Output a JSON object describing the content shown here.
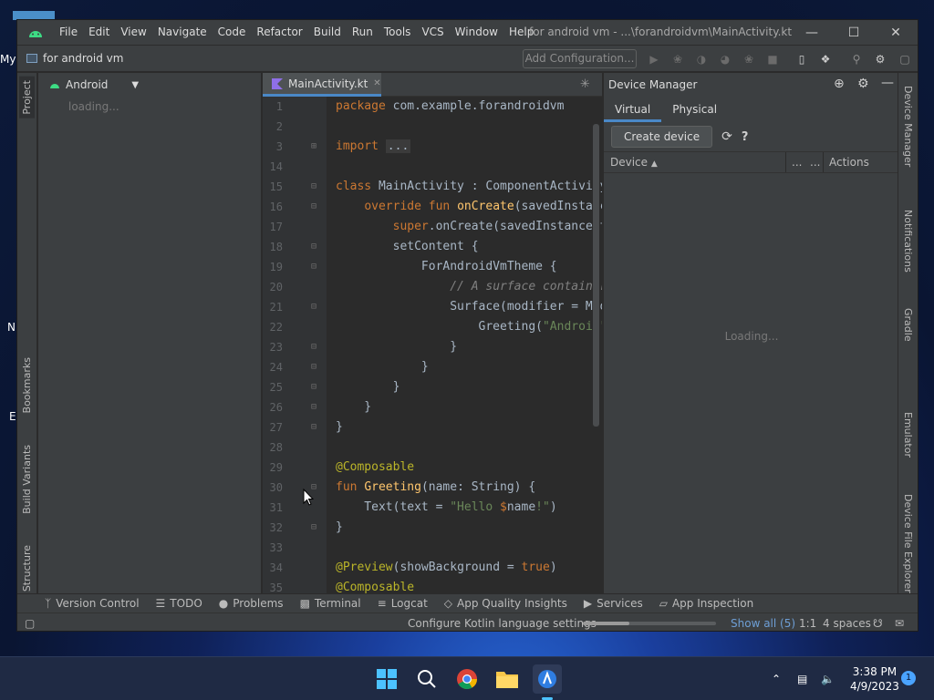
{
  "desktop": {
    "left_glyphs": [
      "My",
      "N",
      "E"
    ]
  },
  "window": {
    "title": "for android vm - ...\\forandroidvm\\MainActivity.kt",
    "menu": [
      "File",
      "Edit",
      "View",
      "Navigate",
      "Code",
      "Refactor",
      "Build",
      "Run",
      "Tools",
      "VCS",
      "Window",
      "Help"
    ]
  },
  "navbar": {
    "project_name": "for android vm",
    "add_config_label": "Add Configuration..."
  },
  "left_stripe": {
    "project": "Project",
    "bookmarks": "Bookmarks",
    "build_variants": "Build Variants",
    "structure": "Structure"
  },
  "right_stripe": {
    "device_manager": "Device Manager",
    "notifications": "Notifications",
    "gradle": "Gradle",
    "emulator": "Emulator",
    "device_file_explorer": "Device File Explorer"
  },
  "project_panel": {
    "view": "Android",
    "loading": "loading..."
  },
  "editor": {
    "tab": "MainActivity.kt",
    "lines": [
      {
        "n": "1"
      },
      {
        "n": "2"
      },
      {
        "n": "3"
      },
      {
        "n": "14"
      },
      {
        "n": "15"
      },
      {
        "n": "16"
      },
      {
        "n": "17"
      },
      {
        "n": "18"
      },
      {
        "n": "19"
      },
      {
        "n": "20"
      },
      {
        "n": "21"
      },
      {
        "n": "22"
      },
      {
        "n": "23"
      },
      {
        "n": "24"
      },
      {
        "n": "25"
      },
      {
        "n": "26"
      },
      {
        "n": "27"
      },
      {
        "n": "28"
      },
      {
        "n": "29"
      },
      {
        "n": "30"
      },
      {
        "n": "31"
      },
      {
        "n": "32"
      },
      {
        "n": "33"
      },
      {
        "n": "34"
      },
      {
        "n": "35"
      }
    ]
  },
  "device_manager": {
    "title": "Device Manager",
    "tabs": [
      "Virtual",
      "Physical"
    ],
    "create_button": "Create device",
    "col_device": "Device",
    "col_dots1": "...",
    "col_dots2": "...",
    "col_actions": "Actions",
    "loading": "Loading..."
  },
  "bottom_tools": [
    "Version Control",
    "TODO",
    "Problems",
    "Terminal",
    "Logcat",
    "App Quality Insights",
    "Services",
    "App Inspection"
  ],
  "status": {
    "message": "Configure Kotlin language settings",
    "show_all": "Show all (5)",
    "position": "1:1",
    "indent": "4 spaces",
    "progress": 0.35
  },
  "taskbar": {
    "time": "3:38 PM",
    "date": "4/9/2023",
    "notifications": "1"
  },
  "colors": {
    "accent": "#4a88c7",
    "keyword": "#cc7832",
    "string": "#6a8759",
    "annotation": "#bbb529",
    "background": "#2b2b2b"
  }
}
